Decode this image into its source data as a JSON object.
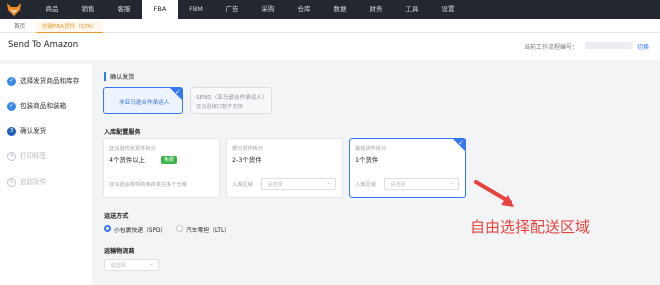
{
  "topnav": {
    "items": [
      "商品",
      "销售",
      "客服",
      "FBA",
      "FBM",
      "广告",
      "采购",
      "仓库",
      "数据",
      "财务",
      "工具",
      "设置"
    ],
    "active": "FBA",
    "accent": "#e89a2d"
  },
  "tabs": [
    "首页",
    "创建FBA货件（STA）"
  ],
  "header": {
    "title": "Send To Amazon",
    "process_label": "当前工作流程编号：",
    "switch_label": "切换"
  },
  "steps": [
    {
      "num": "✓",
      "label": "选择发货商品和库存",
      "state": "done"
    },
    {
      "num": "✓",
      "label": "包装商品和装箱",
      "state": "done"
    },
    {
      "num": "3",
      "label": "确认发货",
      "state": "current"
    },
    {
      "num": "4",
      "label": "打印标签",
      "state": "todo"
    },
    {
      "num": "5",
      "label": "追踪货件",
      "state": "todo"
    }
  ],
  "confirm": {
    "title": "确认发货",
    "option1": "非亚马逊合作承运人",
    "option2_title": "SEND（亚马逊合作承运人）",
    "option2_sub": "亚马逊接口暂不支持"
  },
  "inbound": {
    "title": "入库配置服务",
    "cards": [
      {
        "title": "亚马逊优化货件拆分",
        "value": "4个货件以上",
        "badge": "免费",
        "desc": "亚马逊会将你的库存发往多个仓库"
      },
      {
        "title": "部分货件拆分",
        "value": "2-3个货件",
        "region_label": "入库区域",
        "placeholder": "请选择"
      },
      {
        "title": "最低货件拆分",
        "value": "1个货件",
        "region_label": "入库区域",
        "placeholder": "请选择"
      }
    ]
  },
  "shipping": {
    "title": "运送方式",
    "options": [
      "小包裹快递（SPD）",
      "汽车零担（LTL）"
    ],
    "selected": 0
  },
  "transport": {
    "title": "运输物流商",
    "placeholder": "请选择"
  },
  "annotation": {
    "text": "自由选择配送区域",
    "color": "#e8433d"
  }
}
